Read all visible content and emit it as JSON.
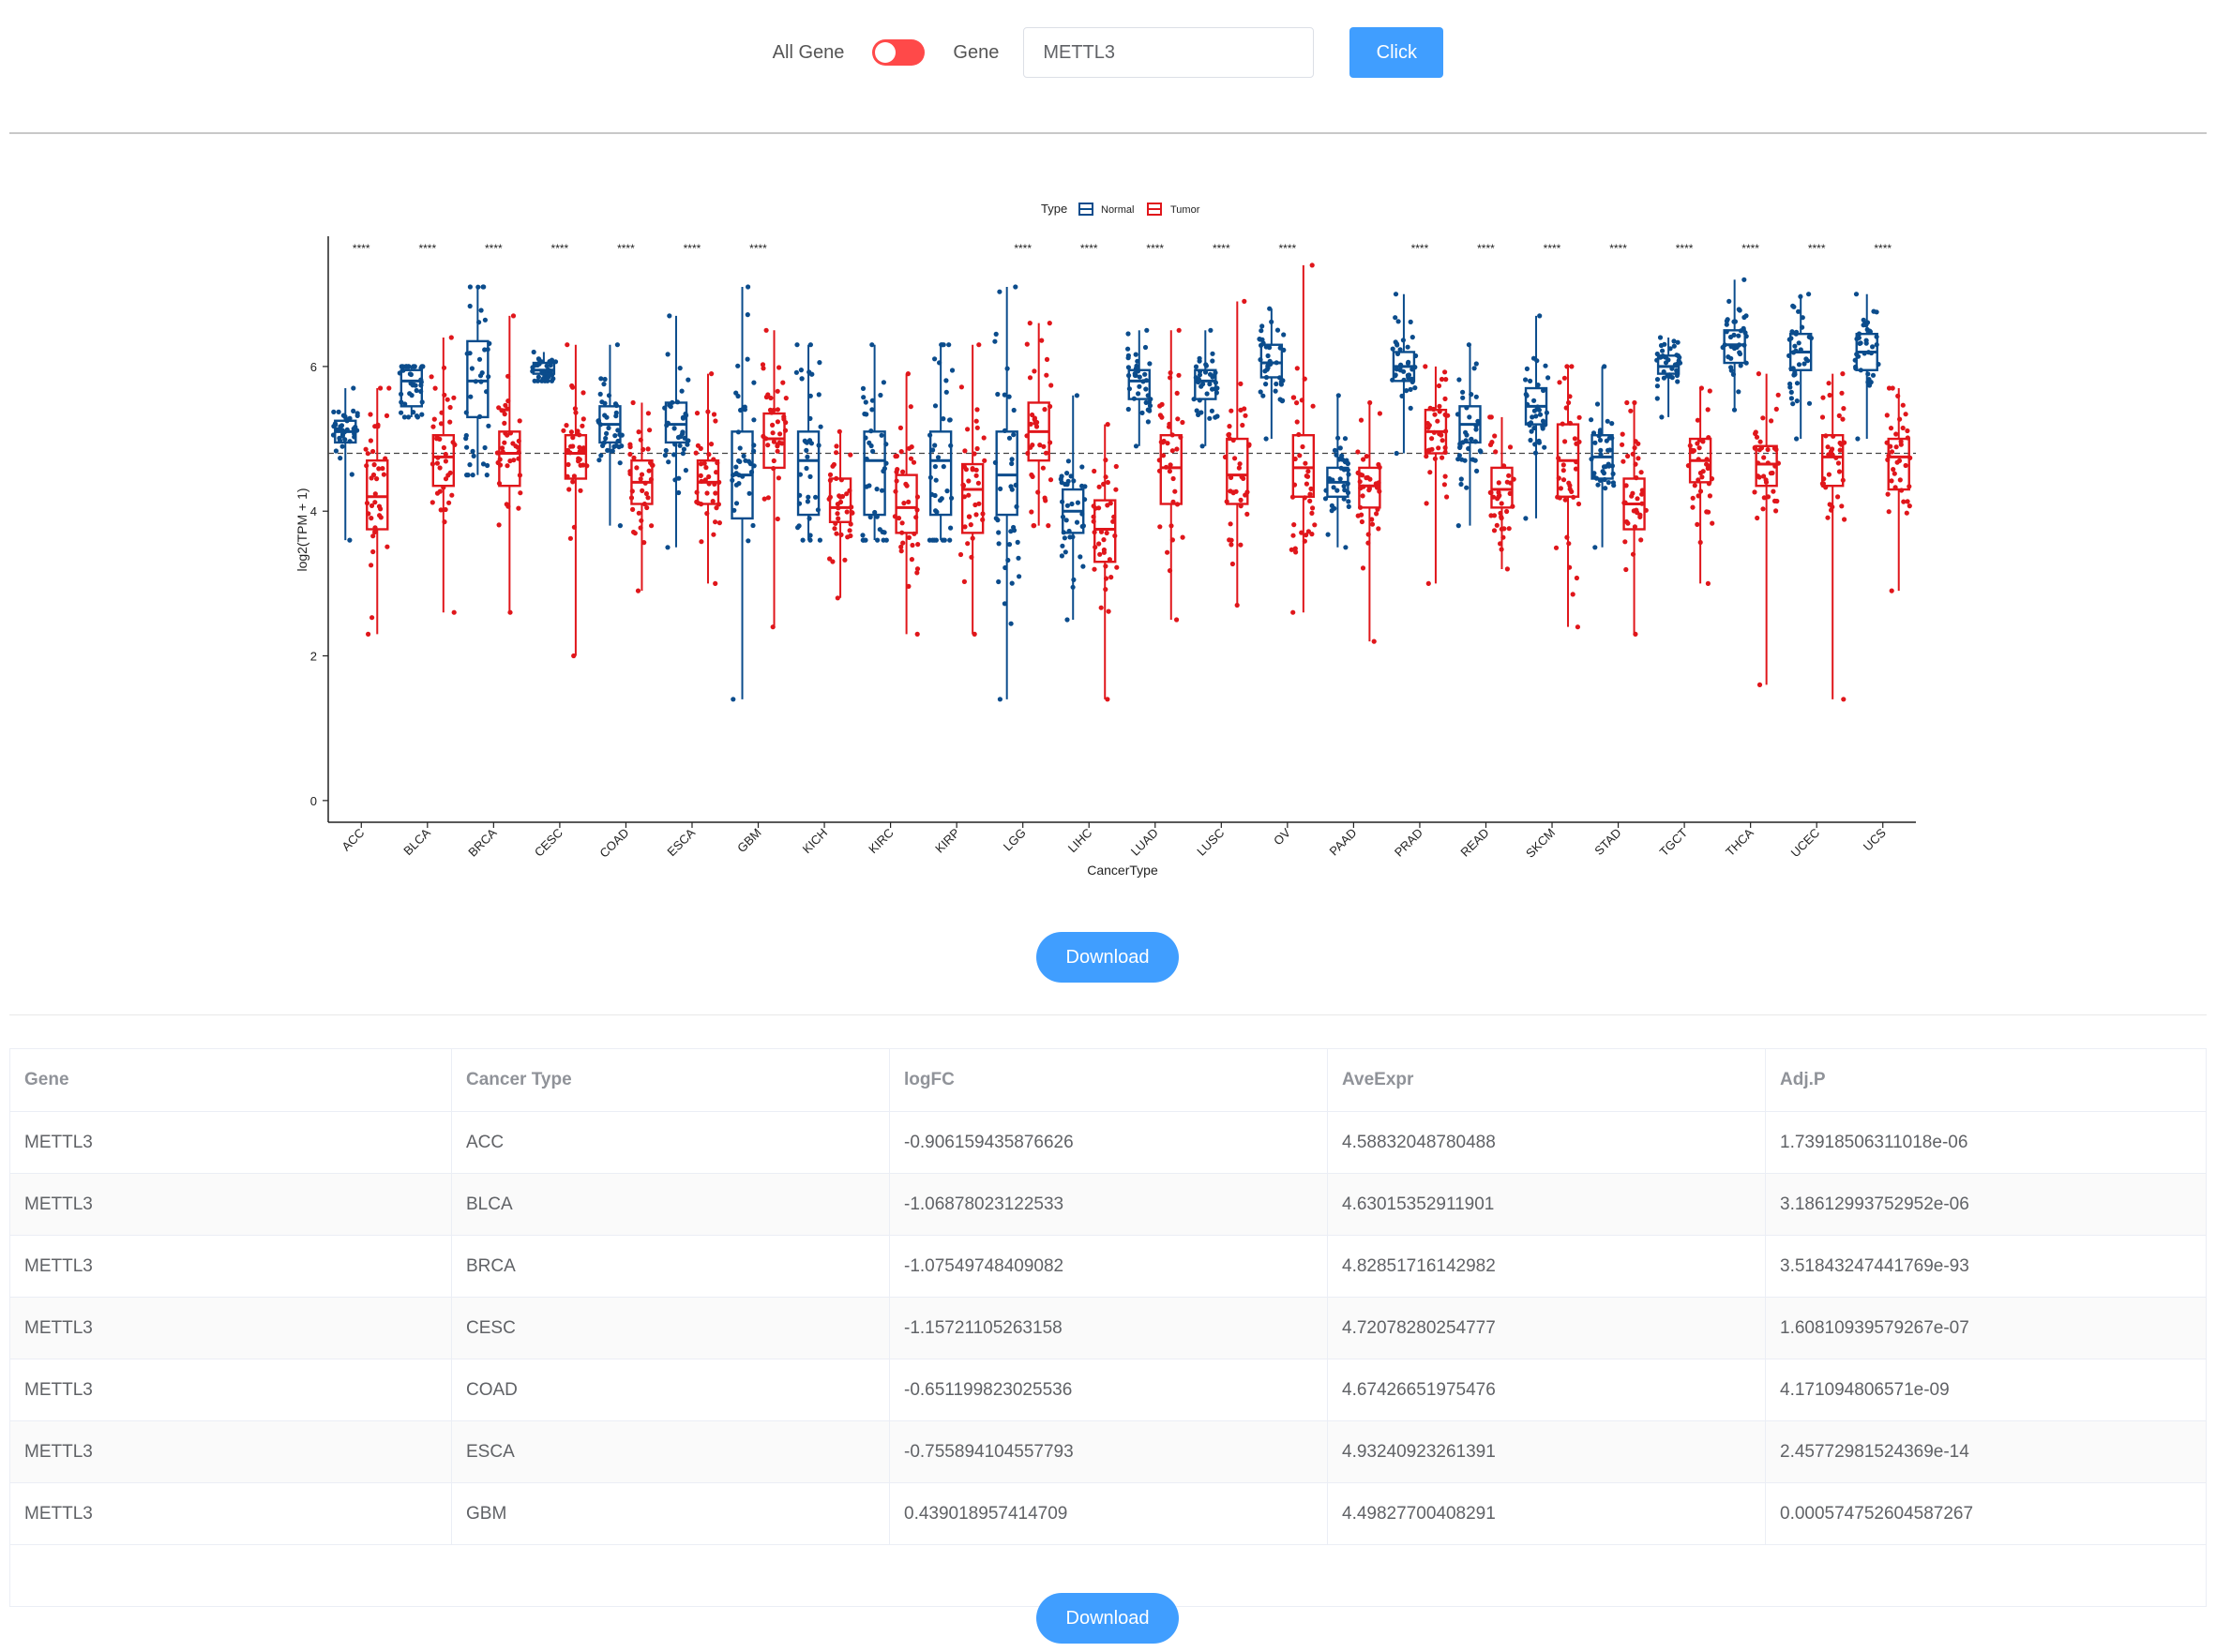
{
  "controls": {
    "all_gene_label": "All Gene",
    "gene_label": "Gene",
    "gene_value": "METTL3",
    "click_label": "Click"
  },
  "colors": {
    "normal": "#0b4c8c",
    "tumor": "#e0161b",
    "accent": "#409eff",
    "switch_on": "#ff4949"
  },
  "chart_data": {
    "type": "box",
    "xlabel": "CancerType",
    "ylabel": "log2(TPM + 1)",
    "legend_title": "Type",
    "legend_position": "top",
    "ylim": [
      -0.3,
      7.8
    ],
    "yticks": [
      0,
      2,
      4,
      6
    ],
    "reference_line": 4.8,
    "series_names": [
      "Normal",
      "Tumor"
    ],
    "categories": [
      "ACC",
      "BLCA",
      "BRCA",
      "CESC",
      "COAD",
      "ESCA",
      "GBM",
      "KICH",
      "KIRC",
      "KIRP",
      "LGG",
      "LIHC",
      "LUAD",
      "LUSC",
      "OV",
      "PAAD",
      "PRAD",
      "READ",
      "SKCM",
      "STAD",
      "TGCT",
      "THCA",
      "UCEC",
      "UCS"
    ],
    "significance": [
      "****",
      "****",
      "****",
      "****",
      "****",
      "****",
      "****",
      "",
      "",
      "",
      "****",
      "****",
      "****",
      "****",
      "****",
      "",
      "****",
      "****",
      "****",
      "****",
      "****",
      "****",
      "****",
      "****"
    ],
    "normal": [
      {
        "q1": 4.95,
        "median": 5.1,
        "q3": 5.25,
        "low": 3.6,
        "high": 5.7
      },
      {
        "q1": 5.45,
        "median": 5.8,
        "q3": 5.95,
        "low": 5.3,
        "high": 6.0
      },
      {
        "q1": 5.3,
        "median": 5.8,
        "q3": 6.35,
        "low": 4.5,
        "high": 7.1
      },
      {
        "q1": 5.9,
        "median": 5.95,
        "q3": 6.05,
        "low": 5.8,
        "high": 6.2
      },
      {
        "q1": 4.95,
        "median": 5.2,
        "q3": 5.45,
        "low": 3.8,
        "high": 6.3
      },
      {
        "q1": 4.95,
        "median": 5.2,
        "q3": 5.5,
        "low": 3.5,
        "high": 6.7
      },
      {
        "q1": 3.9,
        "median": 4.5,
        "q3": 5.1,
        "low": 1.4,
        "high": 7.1
      },
      {
        "q1": 3.95,
        "median": 4.7,
        "q3": 5.1,
        "low": 3.6,
        "high": 6.3
      },
      {
        "q1": 3.95,
        "median": 4.7,
        "q3": 5.1,
        "low": 3.6,
        "high": 6.3
      },
      {
        "q1": 3.95,
        "median": 4.7,
        "q3": 5.1,
        "low": 3.6,
        "high": 6.3
      },
      {
        "q1": 3.95,
        "median": 4.5,
        "q3": 5.1,
        "low": 1.4,
        "high": 7.1
      },
      {
        "q1": 3.7,
        "median": 4.0,
        "q3": 4.3,
        "low": 2.5,
        "high": 5.6
      },
      {
        "q1": 5.55,
        "median": 5.8,
        "q3": 5.95,
        "low": 4.9,
        "high": 6.5
      },
      {
        "q1": 5.55,
        "median": 5.8,
        "q3": 5.95,
        "low": 4.9,
        "high": 6.5
      },
      {
        "q1": 5.85,
        "median": 6.05,
        "q3": 6.3,
        "low": 5.0,
        "high": 6.8
      },
      {
        "q1": 4.2,
        "median": 4.4,
        "q3": 4.6,
        "low": 3.5,
        "high": 5.6
      },
      {
        "q1": 5.8,
        "median": 6.0,
        "q3": 6.2,
        "low": 4.8,
        "high": 7.0
      },
      {
        "q1": 4.95,
        "median": 5.2,
        "q3": 5.45,
        "low": 3.8,
        "high": 6.3
      },
      {
        "q1": 5.2,
        "median": 5.45,
        "q3": 5.7,
        "low": 3.9,
        "high": 6.7
      },
      {
        "q1": 4.45,
        "median": 4.75,
        "q3": 5.05,
        "low": 3.5,
        "high": 6.0
      },
      {
        "q1": 5.9,
        "median": 6.0,
        "q3": 6.15,
        "low": 5.3,
        "high": 6.4
      },
      {
        "q1": 6.05,
        "median": 6.3,
        "q3": 6.5,
        "low": 5.4,
        "high": 7.2
      },
      {
        "q1": 5.95,
        "median": 6.2,
        "q3": 6.45,
        "low": 5.0,
        "high": 7.0
      },
      {
        "q1": 5.95,
        "median": 6.2,
        "q3": 6.45,
        "low": 5.0,
        "high": 7.0
      }
    ],
    "tumor": [
      {
        "q1": 3.75,
        "median": 4.2,
        "q3": 4.7,
        "low": 2.3,
        "high": 5.7
      },
      {
        "q1": 4.35,
        "median": 4.75,
        "q3": 5.05,
        "low": 2.6,
        "high": 6.4
      },
      {
        "q1": 4.35,
        "median": 4.8,
        "q3": 5.1,
        "low": 2.6,
        "high": 6.7
      },
      {
        "q1": 4.45,
        "median": 4.8,
        "q3": 5.05,
        "low": 2.0,
        "high": 6.3
      },
      {
        "q1": 4.1,
        "median": 4.4,
        "q3": 4.7,
        "low": 2.9,
        "high": 5.5
      },
      {
        "q1": 4.1,
        "median": 4.4,
        "q3": 4.7,
        "low": 3.0,
        "high": 5.9
      },
      {
        "q1": 4.6,
        "median": 5.0,
        "q3": 5.35,
        "low": 2.4,
        "high": 6.5
      },
      {
        "q1": 3.85,
        "median": 4.05,
        "q3": 4.45,
        "low": 2.8,
        "high": 5.1
      },
      {
        "q1": 3.7,
        "median": 4.05,
        "q3": 4.5,
        "low": 2.3,
        "high": 5.9
      },
      {
        "q1": 3.7,
        "median": 4.3,
        "q3": 4.65,
        "low": 2.3,
        "high": 6.3
      },
      {
        "q1": 4.7,
        "median": 5.1,
        "q3": 5.5,
        "low": 3.8,
        "high": 6.6
      },
      {
        "q1": 3.3,
        "median": 3.75,
        "q3": 4.15,
        "low": 1.4,
        "high": 5.2
      },
      {
        "q1": 4.1,
        "median": 4.6,
        "q3": 5.05,
        "low": 2.5,
        "high": 6.5
      },
      {
        "q1": 4.1,
        "median": 4.5,
        "q3": 5.0,
        "low": 2.7,
        "high": 6.9
      },
      {
        "q1": 4.2,
        "median": 4.6,
        "q3": 5.05,
        "low": 2.6,
        "high": 7.4
      },
      {
        "q1": 4.05,
        "median": 4.35,
        "q3": 4.6,
        "low": 2.2,
        "high": 5.5
      },
      {
        "q1": 4.8,
        "median": 5.1,
        "q3": 5.4,
        "low": 3.0,
        "high": 6.0
      },
      {
        "q1": 4.05,
        "median": 4.3,
        "q3": 4.6,
        "low": 3.2,
        "high": 5.3
      },
      {
        "q1": 4.2,
        "median": 4.7,
        "q3": 5.2,
        "low": 2.4,
        "high": 6.0
      },
      {
        "q1": 3.75,
        "median": 4.1,
        "q3": 4.45,
        "low": 2.3,
        "high": 5.5
      },
      {
        "q1": 4.4,
        "median": 4.7,
        "q3": 5.0,
        "low": 3.0,
        "high": 5.7
      },
      {
        "q1": 4.35,
        "median": 4.65,
        "q3": 4.9,
        "low": 1.6,
        "high": 5.9
      },
      {
        "q1": 4.35,
        "median": 4.75,
        "q3": 5.05,
        "low": 1.4,
        "high": 5.9
      },
      {
        "q1": 4.3,
        "median": 4.75,
        "q3": 5.0,
        "low": 2.9,
        "high": 5.7
      }
    ]
  },
  "download_label": "Download",
  "table": {
    "columns": [
      "Gene",
      "Cancer Type",
      "logFC",
      "AveExpr",
      "Adj.P"
    ],
    "rows": [
      [
        "METTL3",
        "ACC",
        "-0.906159435876626",
        "4.58832048780488",
        "1.73918506311018e-06"
      ],
      [
        "METTL3",
        "BLCA",
        "-1.06878023122533",
        "4.63015352911901",
        "3.18612993752952e-06"
      ],
      [
        "METTL3",
        "BRCA",
        "-1.07549748409082",
        "4.82851716142982",
        "3.51843247441769e-93"
      ],
      [
        "METTL3",
        "CESC",
        "-1.15721105263158",
        "4.72078280254777",
        "1.60810939579267e-07"
      ],
      [
        "METTL3",
        "COAD",
        "-0.651199823025536",
        "4.67426651975476",
        "4.171094806571e-09"
      ],
      [
        "METTL3",
        "ESCA",
        "-0.755894104557793",
        "4.93240923261391",
        "2.45772981524369e-14"
      ],
      [
        "METTL3",
        "GBM",
        "0.439018957414709",
        "4.49827700408291",
        "0.000574752604587267"
      ]
    ]
  }
}
